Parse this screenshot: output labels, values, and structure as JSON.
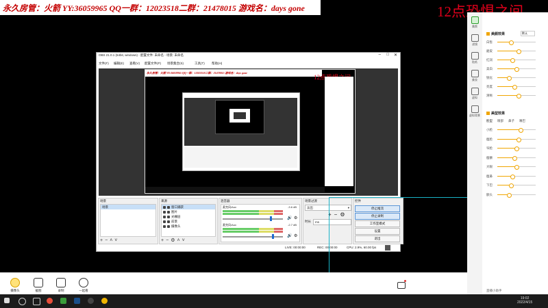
{
  "banner": {
    "text": "永久房管：火箭 YY:36059965 QQ一群：12023518二群：21478015 游戏名：days gone",
    "corner_text": "12点恐惧之间"
  },
  "right_panel": {
    "nav": [
      {
        "label": "美颜",
        "icon": "beauty-icon"
      },
      {
        "label": "滤镜",
        "icon": "filter-icon"
      },
      {
        "label": "贴纸",
        "icon": "sticker-icon"
      },
      {
        "label": "美妆",
        "icon": "makeup-icon"
      },
      {
        "label": "虚拟",
        "icon": "avatar-icon"
      },
      {
        "label": "虚拟背景",
        "icon": "background-icon"
      }
    ],
    "section1_title": "美颜效果",
    "section1_preset": "默认",
    "section1_rows": [
      {
        "label": "白皙",
        "value": "",
        "level": 0.35
      },
      {
        "label": "磨皮",
        "value": "",
        "level": 0.55
      },
      {
        "label": "红润",
        "value": "",
        "level": 0.4
      },
      {
        "label": "美白",
        "value": "",
        "level": 0.5
      },
      {
        "label": "锐化",
        "value": "",
        "level": 0.3
      },
      {
        "label": "亮度",
        "value": "",
        "level": 0.45
      },
      {
        "label": "清晰",
        "value": "",
        "level": 0.55
      }
    ],
    "section2_title": "美型效果",
    "section2_tabs": [
      "脸型",
      "眼部",
      "鼻子",
      "嘴巴"
    ],
    "section2_rows": [
      {
        "label": "小脸",
        "value": "",
        "level": 0.6
      },
      {
        "label": "瘦脸",
        "value": "",
        "level": 0.55
      },
      {
        "label": "窄脸",
        "value": "",
        "level": 0.5
      },
      {
        "label": "瘦颧",
        "value": "",
        "level": 0.45
      },
      {
        "label": "大眼",
        "value": "",
        "level": 0.5
      },
      {
        "label": "瘦鼻",
        "value": "",
        "level": 0.4
      },
      {
        "label": "下巴",
        "value": "",
        "level": 0.35
      },
      {
        "label": "额头",
        "value": "",
        "level": 0.3
      }
    ]
  },
  "obs": {
    "title": "OBS 21.0.1 (64bit, windows) - 配置文件: 未命名 - 场景: 未命名",
    "menu": [
      "文件(F)",
      "编辑(E)",
      "查看(V)",
      "配置文件(P)",
      "场景集合(S)",
      "工具(T)",
      "帮助(H)"
    ],
    "preview_banner": "永久房管：火箭 YY:36059965 QQ一群：12023518二群：21478015 游戏名：days gone",
    "preview_corner": "12点恐惧之间",
    "scenes_title": "场景",
    "scenes": [
      "场景"
    ],
    "sources_title": "来源",
    "sources": [
      "窗口捕获",
      "图片",
      "光栅层",
      "前景",
      "摄像头"
    ],
    "mixer_title": "混音器",
    "mixer": [
      {
        "name": "麦克风/Aux",
        "db": "-3.6 dB",
        "level": 0.78
      },
      {
        "name": "麦克风/Aux",
        "db": "-2.7 dB",
        "level": 0.82
      }
    ],
    "transitions_title": "场景过渡",
    "transition_value": "淡出",
    "duration_label": "时长",
    "duration_value": "ms",
    "controls_title": "控件",
    "controls": [
      "停止推流",
      "停止录制",
      "工作室模式",
      "设置",
      "退出"
    ],
    "status": {
      "live": "LIVE: 00:00:00",
      "rec": "REC: 00:00:00",
      "cpu": "CPU: 2.9%, 60.00 fps"
    }
  },
  "bottom_toolbar": [
    {
      "label": "摄像头",
      "icon": "camera-icon"
    },
    {
      "label": "截图",
      "icon": "screenshot-icon"
    },
    {
      "label": "录制",
      "icon": "record-icon"
    },
    {
      "label": "一起看",
      "icon": "watch-together-icon"
    }
  ],
  "bottom_right_label": "直播小助手",
  "taskbar": {
    "time": "19:02",
    "date": "2022/4/15"
  }
}
